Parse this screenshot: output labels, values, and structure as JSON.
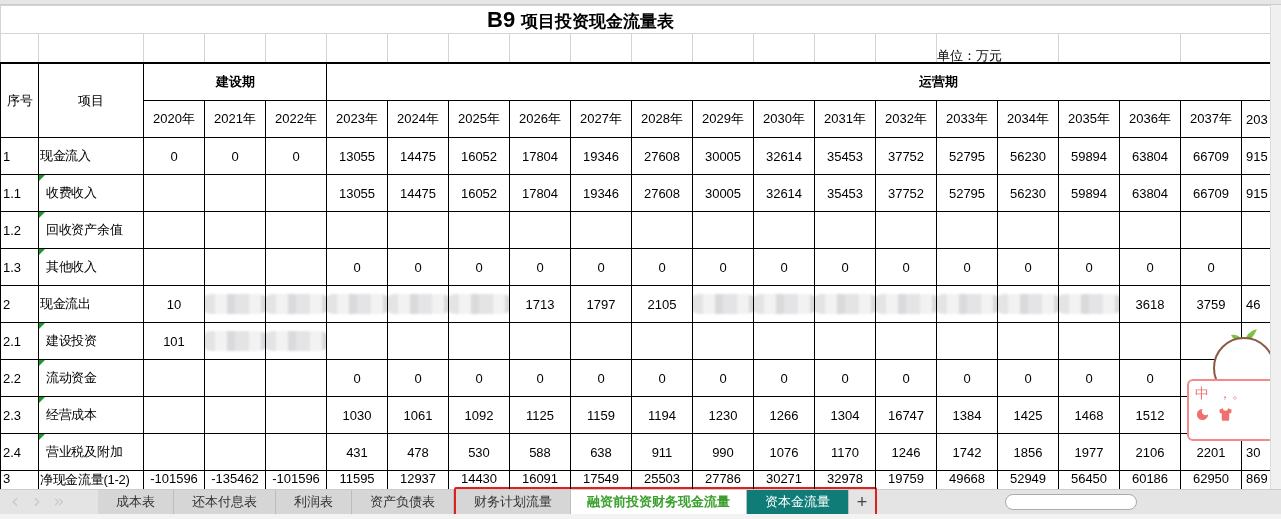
{
  "title_code": "B9",
  "title": "项目投资现金流量表",
  "unit": "单位：万元",
  "header": {
    "no": "序号",
    "item": "项目"
  },
  "construction": {
    "label": "建设期",
    "years": [
      "2020年",
      "2021年",
      "2022年"
    ]
  },
  "operation": {
    "label": "运营期",
    "years": [
      "2023年",
      "2024年",
      "2025年",
      "2026年",
      "2027年",
      "2028年",
      "2029年",
      "2030年",
      "2031年",
      "2032年",
      "2033年",
      "2034年",
      "2035年",
      "2036年",
      "2037年",
      "203"
    ]
  },
  "rows": [
    {
      "no": "1",
      "item": "现金流入",
      "flagged": false,
      "cells": [
        {
          "kind": "number",
          "value": "0"
        },
        {
          "kind": "number",
          "value": "0"
        },
        {
          "kind": "number",
          "value": "0"
        },
        {
          "kind": "number",
          "value": "13055"
        },
        {
          "kind": "number",
          "value": "14475"
        },
        {
          "kind": "number",
          "value": "16052"
        },
        {
          "kind": "number",
          "value": "17804"
        },
        {
          "kind": "number",
          "value": "19346"
        },
        {
          "kind": "number",
          "value": "27608"
        },
        {
          "kind": "number",
          "value": "30005"
        },
        {
          "kind": "number",
          "value": "32614"
        },
        {
          "kind": "number",
          "value": "35453"
        },
        {
          "kind": "number",
          "value": "37752"
        },
        {
          "kind": "number",
          "value": "52795"
        },
        {
          "kind": "number",
          "value": "56230"
        },
        {
          "kind": "number",
          "value": "59894"
        },
        {
          "kind": "number",
          "value": "63804"
        },
        {
          "kind": "number",
          "value": "66709"
        },
        {
          "kind": "number",
          "value": "915"
        }
      ],
      "children": [
        {
          "no": "1.1",
          "item": "收费收入",
          "flagged": true,
          "cells": [
            {
              "kind": "blank"
            },
            {
              "kind": "blank"
            },
            {
              "kind": "blank"
            },
            {
              "kind": "number",
              "value": "13055"
            },
            {
              "kind": "number",
              "value": "14475"
            },
            {
              "kind": "number",
              "value": "16052"
            },
            {
              "kind": "number",
              "value": "17804"
            },
            {
              "kind": "number",
              "value": "19346"
            },
            {
              "kind": "number",
              "value": "27608"
            },
            {
              "kind": "number",
              "value": "30005"
            },
            {
              "kind": "number",
              "value": "32614"
            },
            {
              "kind": "number",
              "value": "35453"
            },
            {
              "kind": "number",
              "value": "37752"
            },
            {
              "kind": "number",
              "value": "52795"
            },
            {
              "kind": "number",
              "value": "56230"
            },
            {
              "kind": "number",
              "value": "59894"
            },
            {
              "kind": "number",
              "value": "63804"
            },
            {
              "kind": "number",
              "value": "66709"
            },
            {
              "kind": "number",
              "value": "915"
            }
          ]
        },
        {
          "no": "1.2",
          "item": "回收资产余值",
          "flagged": true
        },
        {
          "no": "1.3",
          "item": "其他收入",
          "flagged": true,
          "cells": [
            {
              "kind": "blank"
            },
            {
              "kind": "blank"
            },
            {
              "kind": "blank"
            },
            {
              "kind": "number",
              "value": "0"
            },
            {
              "kind": "number",
              "value": "0"
            },
            {
              "kind": "number",
              "value": "0"
            },
            {
              "kind": "number",
              "value": "0"
            },
            {
              "kind": "number",
              "value": "0"
            },
            {
              "kind": "number",
              "value": "0"
            },
            {
              "kind": "number",
              "value": "0"
            },
            {
              "kind": "number",
              "value": "0"
            },
            {
              "kind": "number",
              "value": "0"
            },
            {
              "kind": "number",
              "value": "0"
            },
            {
              "kind": "number",
              "value": "0"
            },
            {
              "kind": "number",
              "value": "0"
            },
            {
              "kind": "number",
              "value": "0"
            },
            {
              "kind": "number",
              "value": "0"
            },
            {
              "kind": "number",
              "value": "0"
            }
          ]
        }
      ]
    },
    {
      "no": "2",
      "item": "现金流出",
      "flagged": false,
      "cells": [
        {
          "kind": "number",
          "value": "10"
        },
        {
          "kind": "blurred"
        },
        {
          "kind": "blurred"
        },
        {
          "kind": "blurred"
        },
        {
          "kind": "blurred"
        },
        {
          "kind": "blurred"
        },
        {
          "kind": "number",
          "value": "1713"
        },
        {
          "kind": "number",
          "value": "1797"
        },
        {
          "kind": "number",
          "value": "2105"
        },
        {
          "kind": "blurred"
        },
        {
          "kind": "blurred"
        },
        {
          "kind": "blurred"
        },
        {
          "kind": "blurred"
        },
        {
          "kind": "blurred"
        },
        {
          "kind": "blurred"
        },
        {
          "kind": "blurred"
        },
        {
          "kind": "number",
          "value": "3618"
        },
        {
          "kind": "number",
          "value": "3759"
        },
        {
          "kind": "number",
          "value": "46"
        }
      ],
      "children": [
        {
          "no": "2.1",
          "item": "建设投资",
          "flagged": true,
          "cells": [
            {
              "kind": "number",
              "value": "101"
            },
            {
              "kind": "blurred"
            },
            {
              "kind": "blurred"
            }
          ]
        },
        {
          "no": "2.2",
          "item": "流动资金",
          "flagged": true,
          "cells": [
            {
              "kind": "blank"
            },
            {
              "kind": "blank"
            },
            {
              "kind": "blank"
            },
            {
              "kind": "number",
              "value": "0"
            },
            {
              "kind": "number",
              "value": "0"
            },
            {
              "kind": "number",
              "value": "0"
            },
            {
              "kind": "number",
              "value": "0"
            },
            {
              "kind": "number",
              "value": "0"
            },
            {
              "kind": "number",
              "value": "0"
            },
            {
              "kind": "number",
              "value": "0"
            },
            {
              "kind": "number",
              "value": "0"
            },
            {
              "kind": "number",
              "value": "0"
            },
            {
              "kind": "number",
              "value": "0"
            },
            {
              "kind": "number",
              "value": "0"
            },
            {
              "kind": "number",
              "value": "0"
            },
            {
              "kind": "number",
              "value": "0"
            },
            {
              "kind": "number",
              "value": "0"
            }
          ]
        },
        {
          "no": "2.3",
          "item": "经营成本",
          "flagged": true,
          "cells": [
            {
              "kind": "blank"
            },
            {
              "kind": "blank"
            },
            {
              "kind": "blank"
            },
            {
              "kind": "number",
              "value": "1030"
            },
            {
              "kind": "number",
              "value": "1061"
            },
            {
              "kind": "number",
              "value": "1092"
            },
            {
              "kind": "number",
              "value": "1125"
            },
            {
              "kind": "number",
              "value": "1159"
            },
            {
              "kind": "number",
              "value": "1194"
            },
            {
              "kind": "number",
              "value": "1230"
            },
            {
              "kind": "number",
              "value": "1266"
            },
            {
              "kind": "number",
              "value": "1304"
            },
            {
              "kind": "number",
              "value": "16747"
            },
            {
              "kind": "number",
              "value": "1384"
            },
            {
              "kind": "number",
              "value": "1425"
            },
            {
              "kind": "number",
              "value": "1468"
            },
            {
              "kind": "number",
              "value": "1512"
            }
          ]
        },
        {
          "no": "2.4",
          "item": "营业税及附加",
          "flagged": true,
          "cells": [
            {
              "kind": "blank"
            },
            {
              "kind": "blank"
            },
            {
              "kind": "blank"
            },
            {
              "kind": "number",
              "value": "431"
            },
            {
              "kind": "number",
              "value": "478"
            },
            {
              "kind": "number",
              "value": "530"
            },
            {
              "kind": "number",
              "value": "588"
            },
            {
              "kind": "number",
              "value": "638"
            },
            {
              "kind": "number",
              "value": "911"
            },
            {
              "kind": "number",
              "value": "990"
            },
            {
              "kind": "number",
              "value": "1076"
            },
            {
              "kind": "number",
              "value": "1170"
            },
            {
              "kind": "number",
              "value": "1246"
            },
            {
              "kind": "number",
              "value": "1742"
            },
            {
              "kind": "number",
              "value": "1856"
            },
            {
              "kind": "number",
              "value": "1977"
            },
            {
              "kind": "number",
              "value": "2106"
            },
            {
              "kind": "number",
              "value": "2201"
            },
            {
              "kind": "number",
              "value": "30"
            }
          ]
        }
      ]
    },
    {
      "no": "3",
      "item": "净现金流量(1-2)",
      "flagged": false,
      "cells": [
        {
          "kind": "number",
          "value": "-101596"
        },
        {
          "kind": "number",
          "value": "-135462"
        },
        {
          "kind": "number",
          "value": "-101596"
        },
        {
          "kind": "number",
          "value": "11595"
        },
        {
          "kind": "number",
          "value": "12937"
        },
        {
          "kind": "number",
          "value": "14430"
        },
        {
          "kind": "number",
          "value": "16091"
        },
        {
          "kind": "number",
          "value": "17549"
        },
        {
          "kind": "number",
          "value": "25503"
        },
        {
          "kind": "number",
          "value": "27786"
        },
        {
          "kind": "number",
          "value": "30271"
        },
        {
          "kind": "number",
          "value": "32978"
        },
        {
          "kind": "number",
          "value": "19759"
        },
        {
          "kind": "number",
          "value": "49668"
        },
        {
          "kind": "number",
          "value": "52949"
        },
        {
          "kind": "number",
          "value": "56450"
        },
        {
          "kind": "number",
          "value": "60186"
        },
        {
          "kind": "number",
          "value": "62950"
        },
        {
          "kind": "number",
          "value": "869"
        }
      ]
    }
  ],
  "sheet_tabs": [
    {
      "label": "成本表",
      "selected": false,
      "highlighted": false
    },
    {
      "label": "还本付息表",
      "selected": false,
      "highlighted": false
    },
    {
      "label": "利润表",
      "selected": false,
      "highlighted": false
    },
    {
      "label": "资产负债表",
      "selected": false,
      "highlighted": false
    },
    {
      "label": "财务计划流量",
      "selected": false,
      "highlighted": true
    },
    {
      "label": "融资前投资财务现金流量",
      "selected": true,
      "highlighted": true
    },
    {
      "label": "资本金流量",
      "selected": false,
      "highlighted": true,
      "color": "#0f7c78"
    }
  ],
  "add_sheet": "+",
  "ime_toolbar": {
    "mode": "中",
    "punctuation": "，。"
  }
}
